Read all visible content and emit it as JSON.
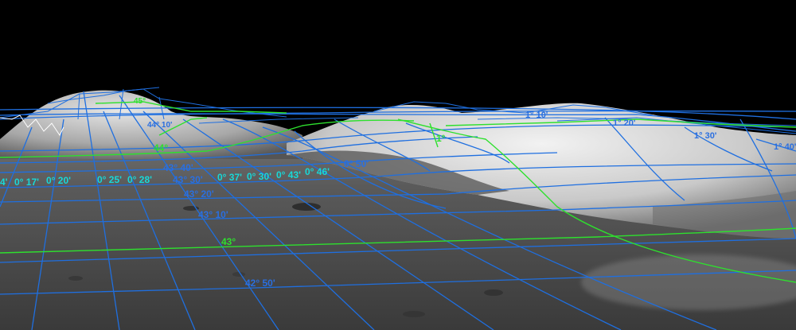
{
  "colors": {
    "sky": "#000000",
    "grid_minor": "#1f6fe0",
    "grid_major": "#2ee02e",
    "label_lon": "#18d8d8",
    "label_lat": "#2a6fe0",
    "label_major": "#2ee02e"
  },
  "grid_labels": {
    "lon": [
      "0° 20'",
      "0° 25'",
      "0° 28'",
      "0° 30'",
      "0° 37'",
      "0° 30'",
      "0° 43'",
      "0° 46'",
      "0° 50'",
      "0° 17'",
      "4'"
    ],
    "lat": [
      "43° 40'",
      "43° 30'",
      "43° 20'",
      "43° 10'",
      "42° 50'"
    ],
    "major": [
      "43°",
      "44°",
      "1°",
      "45°"
    ],
    "far": [
      "1° 10'",
      "1° 20'",
      "1° 30'",
      "1° 40'",
      "44° 10'"
    ]
  }
}
